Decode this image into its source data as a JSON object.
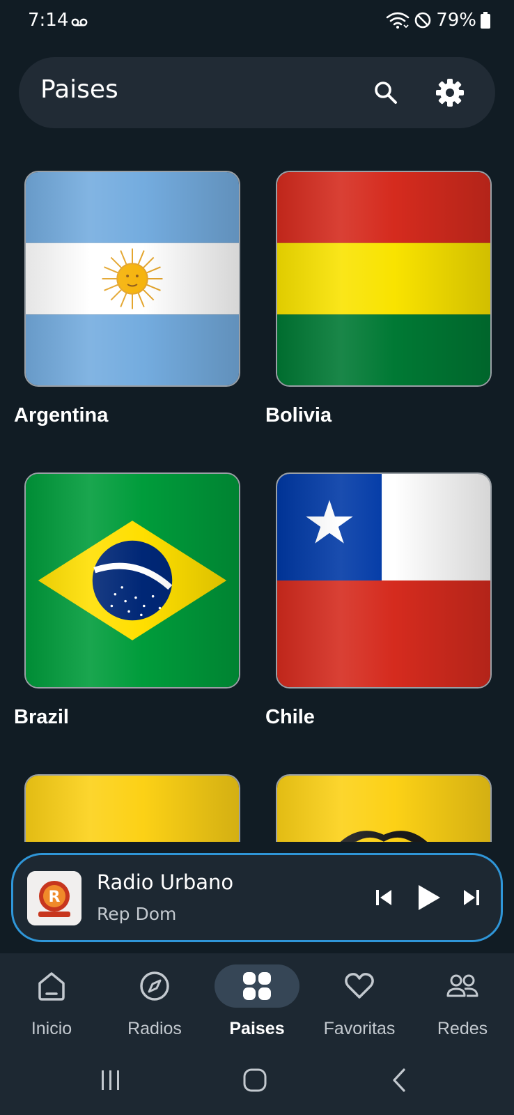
{
  "status_bar": {
    "time": "7:14",
    "battery": "79%"
  },
  "header": {
    "title": "Paises"
  },
  "countries": [
    {
      "name": "Argentina"
    },
    {
      "name": "Bolivia"
    },
    {
      "name": "Brazil"
    },
    {
      "name": "Chile"
    }
  ],
  "player": {
    "title": "Radio Urbano",
    "subtitle": "Rep Dom"
  },
  "nav": {
    "items": [
      {
        "label": "Inicio"
      },
      {
        "label": "Radios"
      },
      {
        "label": "Paises"
      },
      {
        "label": "Favoritas"
      },
      {
        "label": "Redes"
      }
    ],
    "active": "Paises"
  },
  "colors": {
    "background": "#111c24",
    "surface": "#212b35",
    "player_border": "#2f96d8",
    "nav_active_pill": "#364656"
  },
  "icons": [
    "voicemail-icon",
    "wifi-icon",
    "do-not-disturb-icon",
    "battery-icon",
    "search-icon",
    "gear-icon",
    "skip-previous-icon",
    "play-icon",
    "skip-next-icon",
    "home-icon",
    "compass-icon",
    "grid-icon",
    "heart-icon",
    "people-icon",
    "recents-icon",
    "home-circle-icon",
    "back-icon"
  ]
}
